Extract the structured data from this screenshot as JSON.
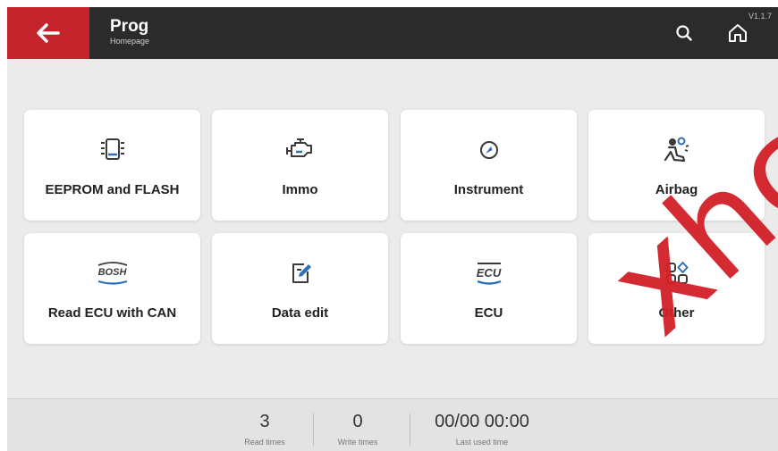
{
  "header": {
    "title": "Prog",
    "subtitle": "Homepage",
    "version": "V1.1.7"
  },
  "tiles": [
    {
      "label": "EEPROM and FLASH",
      "icon": "chip-icon"
    },
    {
      "label": "Immo",
      "icon": "engine-icon"
    },
    {
      "label": "Instrument",
      "icon": "gauge-icon"
    },
    {
      "label": "Airbag",
      "icon": "airbag-icon"
    },
    {
      "label": "Read ECU with CAN",
      "icon": "bosh-icon",
      "icon_text": "BOSH"
    },
    {
      "label": "Data edit",
      "icon": "edit-icon"
    },
    {
      "label": "ECU",
      "icon": "ecu-icon",
      "icon_text": "ECU"
    },
    {
      "label": "Other",
      "icon": "apps-icon"
    }
  ],
  "footer": {
    "read_times": {
      "value": "3",
      "caption": "Read times"
    },
    "write_times": {
      "value": "0",
      "caption": "Write times"
    },
    "last_used": {
      "value": "00/00 00:00",
      "caption": "Last used time"
    }
  },
  "watermark": "xhc",
  "colors": {
    "accent": "#c4232b",
    "header": "#2b2b2b",
    "icon": "#2f6fb5",
    "background": "#ebebeb"
  }
}
